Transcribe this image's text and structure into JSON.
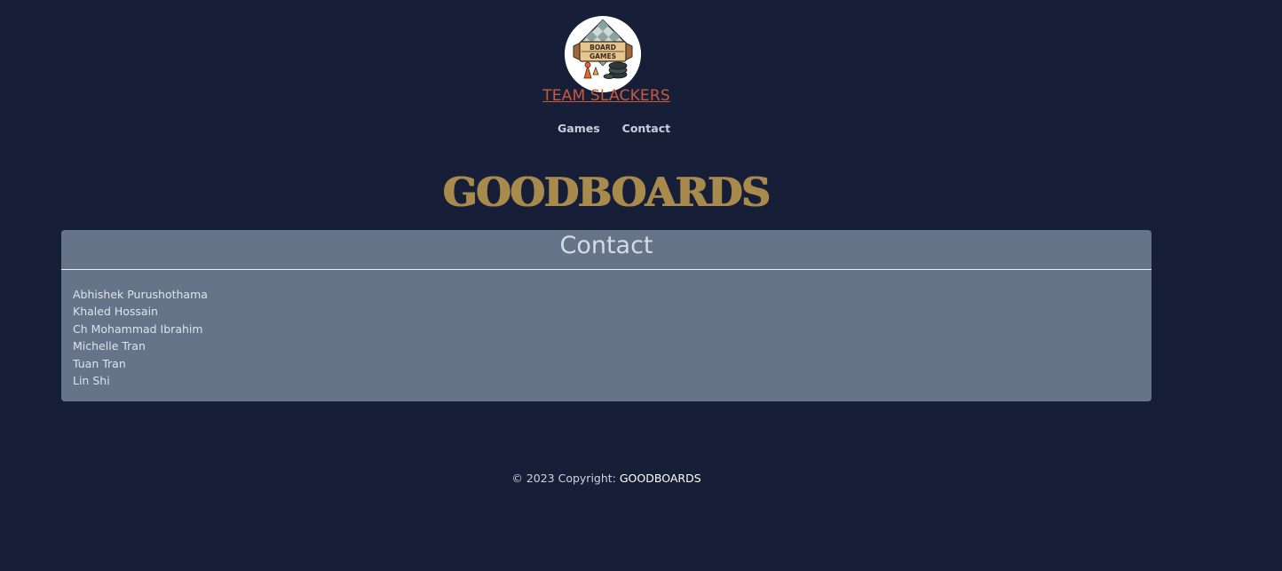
{
  "header": {
    "logo_text_line1": "BOARD",
    "logo_text_line2": "GAMES",
    "team_name": "TEAM SLACKERS",
    "nav": [
      {
        "label": "Games"
      },
      {
        "label": "Contact"
      }
    ]
  },
  "brand": {
    "title": "GOODBOARDS"
  },
  "contact": {
    "title": "Contact",
    "people": [
      "Abhishek Purushothama",
      "Khaled Hossain",
      "Ch Mohammad Ibrahim",
      "Michelle Tran",
      "Tuan Tran",
      "Lin Shi"
    ]
  },
  "footer": {
    "copyright_prefix": "© 2023 Copyright: ",
    "link": "GOODBOARDS"
  },
  "colors": {
    "background": "#171e38",
    "accent_red": "#c95a3a",
    "brand_gold": "#a88b4c",
    "card": "#657489"
  }
}
